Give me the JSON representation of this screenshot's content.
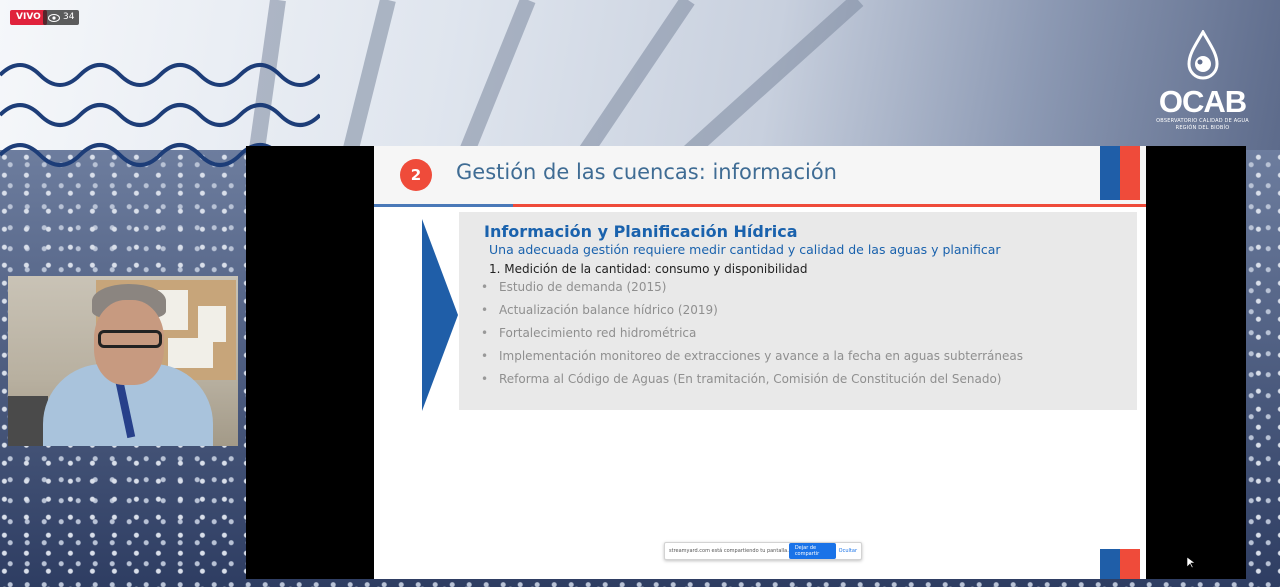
{
  "stream": {
    "live_label": "VIVO",
    "viewer_count": "34"
  },
  "logo": {
    "name": "OCAB",
    "subtitle_line1": "OBSERVATORIO CALIDAD DE AGUA",
    "subtitle_line2": "REGIÓN DEL BIOBÍO"
  },
  "slide": {
    "number": "2",
    "title": "Gestión de las cuencas: información",
    "heading": "Información y Planificación Hídrica",
    "subheading": "Una adecuada gestión requiere medir cantidad y calidad de las aguas  y planificar",
    "section": "1. Medición de la cantidad: consumo y disponibilidad",
    "bullets": [
      "Estudio de demanda  (2015)",
      "Actualización balance hídrico (2019)",
      "Fortalecimiento red hidrométrica",
      "Implementación monitoreo de extracciones y avance a la fecha en aguas subterráneas",
      "Reforma al Código de Aguas (En tramitación, Comisión de Constitución del Senado)"
    ]
  },
  "share_bar": {
    "message": "streamyard.com está compartiendo tu pantalla.",
    "stop_button": "Dejar de compartir",
    "hide_button": "Ocultar"
  },
  "colors": {
    "live_red": "#e0223c",
    "slide_title_blue": "#3f6c94",
    "heading_blue": "#1a62ad",
    "accent_red": "#ef4b3a",
    "flag_blue": "#1f5ea8"
  }
}
